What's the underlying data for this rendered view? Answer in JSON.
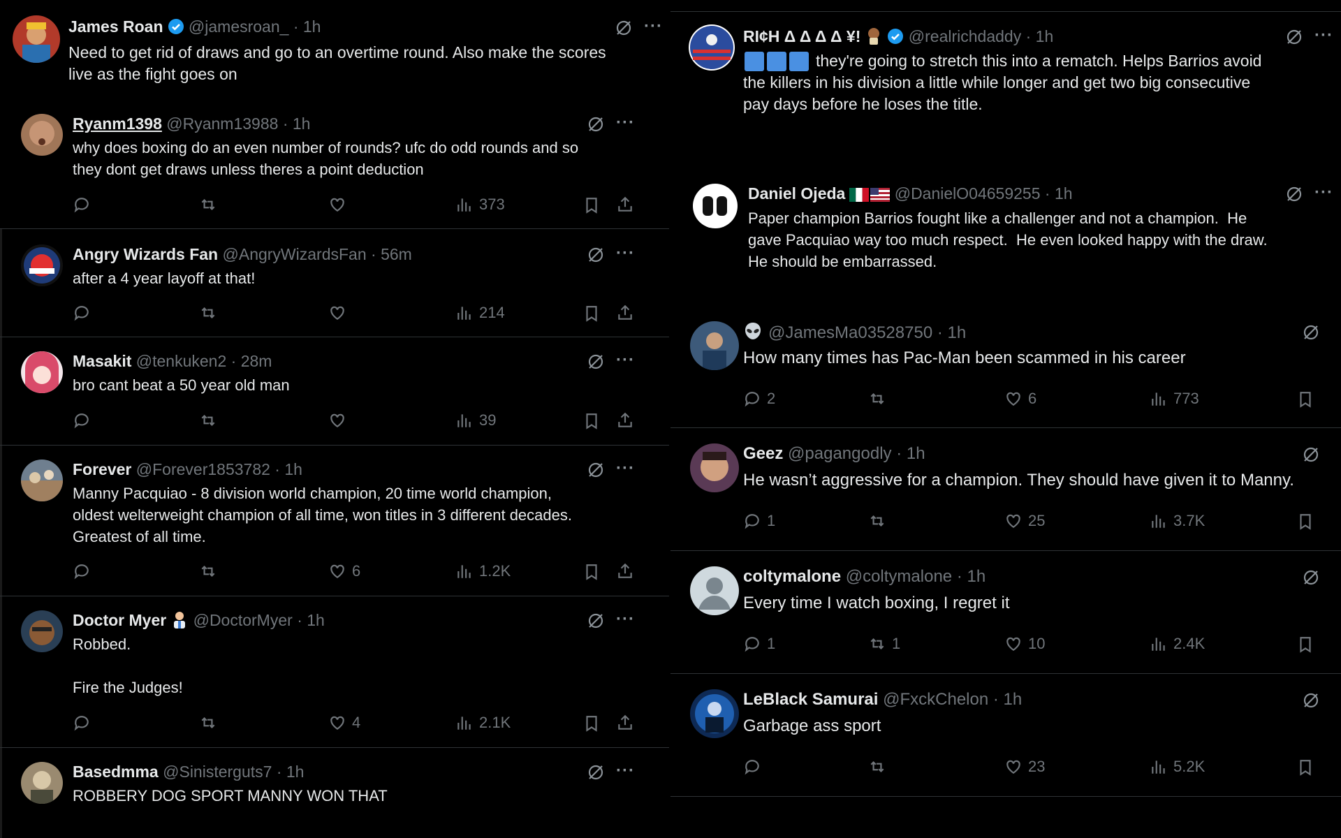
{
  "left": {
    "top_post": {
      "name": "James Roan",
      "handle": "@jamesroan_",
      "time": "1h",
      "text": "Need to get rid of draws and go to an overtime round. Also make the scores\nlive as the fight goes on",
      "avatar_color": "#b23a2a"
    },
    "replies": [
      {
        "name": "Ryanm1398",
        "handle": "@Ryanm13988",
        "time": "1h",
        "text": "why does boxing do an even number of rounds? ufc do odd rounds and so\nthey dont get draws unless theres a point deduction",
        "replies": "",
        "reposts": "",
        "likes": "",
        "views": "373",
        "avatar_color": "#a07658"
      },
      {
        "name": "Angry Wizards Fan",
        "handle": "@AngryWizardsFan",
        "time": "56m",
        "text": "after a 4 year layoff at that!",
        "replies": "",
        "reposts": "",
        "likes": "",
        "views": "214",
        "avatar_color": "#1f3b78"
      },
      {
        "name": "Masakit",
        "handle": "@tenkuken2",
        "time": "28m",
        "text": "bro cant beat a 50 year old man",
        "replies": "",
        "reposts": "",
        "likes": "",
        "views": "39",
        "avatar_color": "#d94b6a"
      },
      {
        "name": "Forever",
        "handle": "@Forever1853782",
        "time": "1h",
        "text": "Manny Pacquiao - 8 division world champion, 20 time world champion,\noldest welterweight champion of all time, won titles in 3 different decades.\nGreatest of all time.",
        "replies": "",
        "reposts": "",
        "likes": "6",
        "views": "1.2K",
        "avatar_color": "#6f7f8f"
      },
      {
        "name": "Doctor Myer",
        "handle": "@DoctorMyer",
        "time": "1h",
        "text": "Robbed.\n\nFire the Judges!",
        "replies": "",
        "reposts": "",
        "likes": "4",
        "views": "2.1K",
        "avatar_color": "#8a5a35"
      },
      {
        "name": "Basedmma",
        "handle": "@Sinisterguts7",
        "time": "1h",
        "text": "ROBBERY DOG SPORT MANNY WON THAT",
        "avatar_color": "#9a8a70"
      }
    ]
  },
  "right": {
    "top_post": {
      "name": "RI¢H Δ Δ Δ Δ ¥!",
      "handle": "@realrichdaddy",
      "time": "1h",
      "text": "they're going to stretch this into a rematch. Helps Barrios avoid\nthe killers in his division a little while longer and get two big consecutive\npay days before he loses the title.",
      "avatar_color": "#2b4c9e"
    },
    "quote_post": {
      "name": "Daniel Ojeda",
      "handle": "@DanielO04659255",
      "time": "1h",
      "text": "Paper champion Barrios fought like a challenger and not a champion.  He\ngave Pacquiao way too much respect.  He even looked happy with the draw.\nHe should be embarrassed."
    },
    "replies": [
      {
        "name": "",
        "handle": "@JamesMa03528750",
        "time": "1h",
        "text": "How many times has Pac-Man been scammed in his career",
        "replies": "2",
        "reposts": "",
        "likes": "6",
        "views": "773",
        "avatar_color": "#3d5a7a"
      },
      {
        "name": "Geez",
        "handle": "@pagangodly",
        "time": "1h",
        "text": "He wasn’t aggressive for a champion. They should have given it to Manny.",
        "replies": "1",
        "reposts": "",
        "likes": "25",
        "views": "3.7K",
        "avatar_color": "#7a4a3a"
      },
      {
        "name": "coltymalone",
        "handle": "@coltymalone",
        "time": "1h",
        "text": "Every time I watch boxing, I regret it",
        "replies": "1",
        "reposts": "1",
        "likes": "10",
        "views": "2.4K",
        "avatar_color": "#cfd9de"
      },
      {
        "name": "LeBlack Samurai",
        "handle": "@FxckChelon",
        "time": "1h",
        "text": "Garbage ass sport",
        "replies": "",
        "reposts": "",
        "likes": "23",
        "views": "5.2K",
        "avatar_color": "#1f5fb0"
      }
    ]
  },
  "ui": {
    "more_glyph": "···",
    "dot": "·"
  }
}
